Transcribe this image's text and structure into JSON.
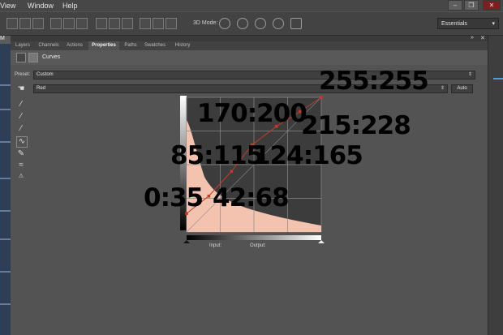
{
  "menu": {
    "items": [
      "View",
      "Window",
      "Help"
    ]
  },
  "mode3d_label": "3D Mode:",
  "workspace": {
    "selected": "Essentials"
  },
  "document_tab": {
    "label": "M"
  },
  "panel_tabs": [
    "Layers",
    "Channels",
    "Actions",
    "Properties",
    "Paths",
    "Swatches",
    "History"
  ],
  "active_tab": "Properties",
  "adjustment": {
    "title": "Curves"
  },
  "preset": {
    "label": "Preset:",
    "value": "Custom"
  },
  "channel": {
    "value": "Red"
  },
  "auto_label": "Auto",
  "input_label": "Input:",
  "output_label": "Output:",
  "annotations": [
    "255:255",
    "170:200",
    "215:228",
    "85:115",
    "124:165",
    "0:35",
    "42:68"
  ],
  "chart_data": {
    "type": "line",
    "title": "",
    "xlim": [
      0,
      255
    ],
    "ylim": [
      0,
      255
    ],
    "grid": true,
    "series": [
      {
        "values": [
          [
            0,
            35
          ],
          [
            42,
            68
          ],
          [
            85,
            115
          ],
          [
            124,
            165
          ],
          [
            170,
            200
          ],
          [
            215,
            228
          ],
          [
            255,
            255
          ]
        ]
      }
    ],
    "histogram_color": "#f3c3b0",
    "curve_color": "#c23b2a"
  },
  "colors": {
    "accent": "#c23b2a",
    "panel": "#535353"
  }
}
